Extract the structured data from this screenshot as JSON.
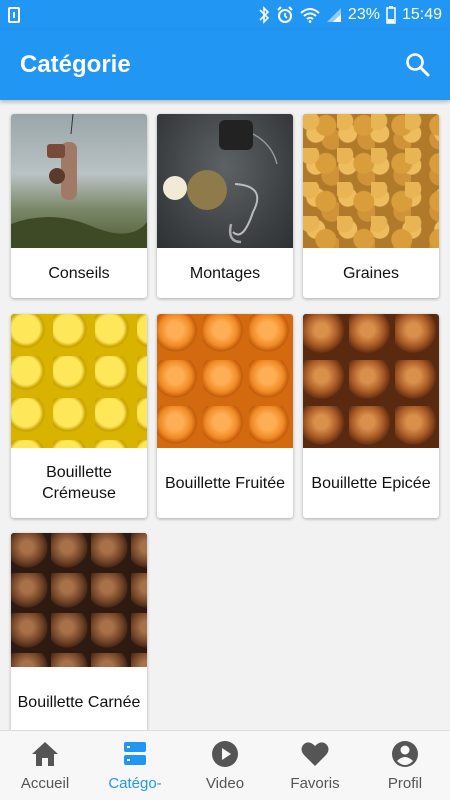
{
  "status_bar": {
    "battery_percent": "23%",
    "time": "15:49",
    "icons": [
      "sim-card-icon",
      "bluetooth-icon",
      "alarm-icon",
      "wifi-icon",
      "signal-icon",
      "battery-icon"
    ]
  },
  "app_bar": {
    "title": "Catégorie",
    "search_icon": "search-icon"
  },
  "categories": [
    {
      "label": "Conseils"
    },
    {
      "label": "Montages"
    },
    {
      "label": "Graines"
    },
    {
      "label": "Bouillette Crémeuse"
    },
    {
      "label": "Bouillette Fruitée"
    },
    {
      "label": "Bouillette Epicée"
    },
    {
      "label": "Bouillette Carnée"
    }
  ],
  "bottom_nav": {
    "items": [
      {
        "label": "Accueil",
        "icon": "home-icon",
        "active": false
      },
      {
        "label": "Catégo-",
        "icon": "category-list-icon",
        "active": true
      },
      {
        "label": "Video",
        "icon": "play-icon",
        "active": false
      },
      {
        "label": "Favoris",
        "icon": "heart-icon",
        "active": false
      },
      {
        "label": "Profil",
        "icon": "account-icon",
        "active": false
      }
    ]
  },
  "colors": {
    "primary": "#2196f3",
    "nav_inactive": "#555555",
    "background": "#f2f2f2"
  }
}
